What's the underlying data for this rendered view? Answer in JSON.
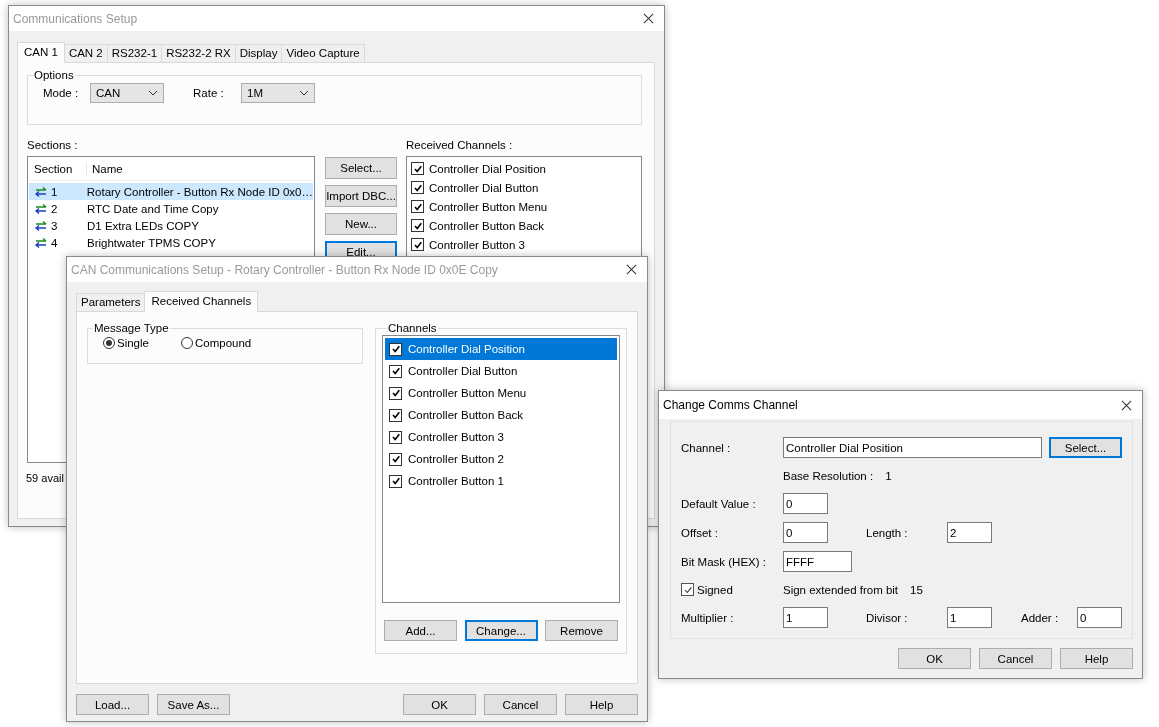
{
  "communications_setup": {
    "title": "Communications Setup",
    "active": false,
    "tabs": [
      {
        "label": "CAN 1",
        "selected": true
      },
      {
        "label": "CAN 2",
        "selected": false
      },
      {
        "label": "RS232-1",
        "selected": false
      },
      {
        "label": "RS232-2 RX",
        "selected": false
      },
      {
        "label": "Display",
        "selected": false
      },
      {
        "label": "Video Capture",
        "selected": false
      }
    ],
    "options": {
      "title": "Options",
      "mode_label": "Mode :",
      "mode_value": "CAN",
      "rate_label": "Rate :",
      "rate_value": "1M"
    },
    "sections": {
      "label": "Sections :",
      "columns": [
        "Section",
        "Name"
      ],
      "rows": [
        {
          "number": "1",
          "name": "Rotary Controller - Button Rx Node ID 0x0…",
          "selected": true
        },
        {
          "number": "2",
          "name": "RTC Date and Time Copy",
          "selected": false
        },
        {
          "number": "3",
          "name": "D1 Extra LEDs COPY",
          "selected": false
        },
        {
          "number": "4",
          "name": "Brightwater TPMS COPY",
          "selected": false
        }
      ]
    },
    "buttons": [
      {
        "label": "Select...",
        "focused": false
      },
      {
        "label": "Import DBC...",
        "focused": false
      },
      {
        "label": "New...",
        "focused": false
      },
      {
        "label": "Edit...",
        "focused": true
      }
    ],
    "received_channels": {
      "label": "Received Channels :",
      "items": [
        {
          "label": "Controller Dial Position",
          "checked": true
        },
        {
          "label": "Controller Dial Button",
          "checked": true
        },
        {
          "label": "Controller Button Menu",
          "checked": true
        },
        {
          "label": "Controller Button Back",
          "checked": true
        },
        {
          "label": "Controller Button 3",
          "checked": true
        }
      ]
    },
    "status": "59 avail"
  },
  "can_setup": {
    "title": "CAN Communications Setup - Rotary Controller - Button Rx Node ID 0x0E Copy",
    "active": false,
    "tabs": [
      {
        "label": "Parameters",
        "selected": false
      },
      {
        "label": "Received Channels",
        "selected": true
      }
    ],
    "message_type": {
      "title": "Message Type",
      "options": [
        {
          "label": "Single",
          "selected": true
        },
        {
          "label": "Compound",
          "selected": false
        }
      ]
    },
    "channels": {
      "title": "Channels",
      "items": [
        {
          "label": "Controller Dial Position",
          "checked": true,
          "selected": true
        },
        {
          "label": "Controller Dial Button",
          "checked": true,
          "selected": false
        },
        {
          "label": "Controller Button Menu",
          "checked": true,
          "selected": false
        },
        {
          "label": "Controller Button Back",
          "checked": true,
          "selected": false
        },
        {
          "label": "Controller Button 3",
          "checked": true,
          "selected": false
        },
        {
          "label": "Controller Button 2",
          "checked": true,
          "selected": false
        },
        {
          "label": "Controller Button 1",
          "checked": true,
          "selected": false
        }
      ],
      "buttons": [
        {
          "label": "Add...",
          "focused": false
        },
        {
          "label": "Change...",
          "focused": true
        },
        {
          "label": "Remove",
          "focused": false
        }
      ]
    },
    "left_buttons": [
      {
        "label": "Load...",
        "focused": false
      },
      {
        "label": "Save As...",
        "focused": false
      }
    ],
    "right_buttons": [
      {
        "label": "OK",
        "focused": false
      },
      {
        "label": "Cancel",
        "focused": false
      },
      {
        "label": "Help",
        "focused": false
      }
    ]
  },
  "change_channel": {
    "title": "Change Comms Channel",
    "active": true,
    "channel": {
      "label": "Channel :",
      "value": "Controller Dial Position"
    },
    "select_button": {
      "label": "Select...",
      "focused": true
    },
    "base_resolution": {
      "label": "Base Resolution :",
      "value": "1"
    },
    "default_value": {
      "label": "Default Value :",
      "value": "0"
    },
    "offset": {
      "label": "Offset :",
      "value": "0"
    },
    "length": {
      "label": "Length :",
      "value": "2"
    },
    "bit_mask": {
      "label": "Bit Mask (HEX) :",
      "value": "FFFF"
    },
    "signed": {
      "label": "Signed",
      "checked": true
    },
    "sign_extended": {
      "label": "Sign extended from bit",
      "value": "15"
    },
    "multiplier": {
      "label": "Multiplier :",
      "value": "1"
    },
    "divisor": {
      "label": "Divisor :",
      "value": "1"
    },
    "adder": {
      "label": "Adder :",
      "value": "0"
    },
    "buttons": [
      {
        "label": "OK",
        "focused": false
      },
      {
        "label": "Cancel",
        "focused": false
      },
      {
        "label": "Help",
        "focused": false
      }
    ]
  }
}
